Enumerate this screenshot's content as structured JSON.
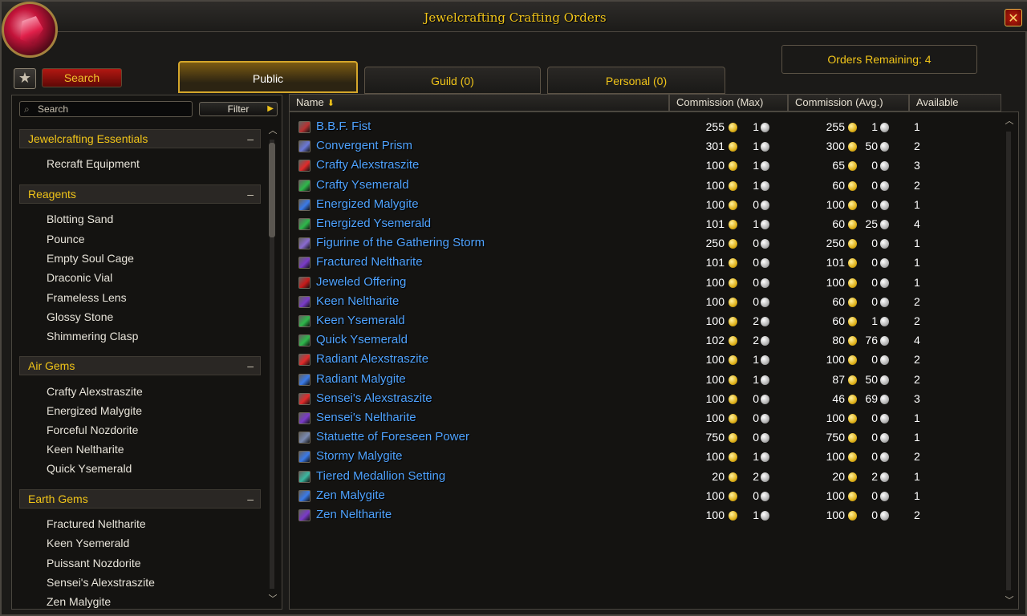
{
  "window": {
    "title": "Jewelcrafting Crafting Orders",
    "close_glyph": "✕"
  },
  "toolbar": {
    "star_glyph": "★",
    "search_label": "Search"
  },
  "tabs": [
    {
      "label": "Public",
      "active": true
    },
    {
      "label": "Guild (0)",
      "active": false
    },
    {
      "label": "Personal (0)",
      "active": false
    }
  ],
  "orders_remaining": "Orders Remaining: 4",
  "sidebar": {
    "search_placeholder": "Search",
    "filter_label": "Filter",
    "categories": [
      {
        "name": "Jewelcrafting Essentials",
        "items": [
          "Recraft Equipment"
        ]
      },
      {
        "name": "Reagents",
        "items": [
          "Blotting Sand",
          "Pounce",
          "Empty Soul Cage",
          "Draconic Vial",
          "Frameless Lens",
          "Glossy Stone",
          "Shimmering Clasp"
        ]
      },
      {
        "name": "Air Gems",
        "items": [
          "Crafty Alexstraszite",
          "Energized Malygite",
          "Forceful Nozdorite",
          "Keen Neltharite",
          "Quick Ysemerald"
        ]
      },
      {
        "name": "Earth Gems",
        "items": [
          "Fractured Neltharite",
          "Keen Ysemerald",
          "Puissant Nozdorite",
          "Sensei's Alexstraszite",
          "Zen Malygite"
        ]
      }
    ]
  },
  "table": {
    "columns": [
      "Name",
      "Commission (Max)",
      "Commission (Avg.)",
      "Available"
    ],
    "rows": [
      {
        "name": "B.B.F. Fist",
        "icon_color": "#b83232",
        "max_g": "255",
        "max_s": "1",
        "avg_g": "255",
        "avg_s": "1",
        "available": "1"
      },
      {
        "name": "Convergent Prism",
        "icon_color": "#6a78d8",
        "max_g": "301",
        "max_s": "1",
        "avg_g": "300",
        "avg_s": "50",
        "available": "2"
      },
      {
        "name": "Crafty Alexstraszite",
        "icon_color": "#e02a2a",
        "max_g": "100",
        "max_s": "1",
        "avg_g": "65",
        "avg_s": "0",
        "available": "3"
      },
      {
        "name": "Crafty Ysemerald",
        "icon_color": "#2eb84a",
        "max_g": "100",
        "max_s": "1",
        "avg_g": "60",
        "avg_s": "0",
        "available": "2"
      },
      {
        "name": "Energized Malygite",
        "icon_color": "#3a7ae8",
        "max_g": "100",
        "max_s": "0",
        "avg_g": "100",
        "avg_s": "0",
        "available": "1"
      },
      {
        "name": "Energized Ysemerald",
        "icon_color": "#2eb84a",
        "max_g": "101",
        "max_s": "1",
        "avg_g": "60",
        "avg_s": "25",
        "available": "4"
      },
      {
        "name": "Figurine of the Gathering Storm",
        "icon_color": "#8a6ad0",
        "max_g": "250",
        "max_s": "0",
        "avg_g": "250",
        "avg_s": "0",
        "available": "1"
      },
      {
        "name": "Fractured Neltharite",
        "icon_color": "#7a3ac8",
        "max_g": "101",
        "max_s": "0",
        "avg_g": "101",
        "avg_s": "0",
        "available": "1"
      },
      {
        "name": "Jeweled Offering",
        "icon_color": "#c81a1a",
        "max_g": "100",
        "max_s": "0",
        "avg_g": "100",
        "avg_s": "0",
        "available": "1"
      },
      {
        "name": "Keen Neltharite",
        "icon_color": "#7a3ac8",
        "max_g": "100",
        "max_s": "0",
        "avg_g": "60",
        "avg_s": "0",
        "available": "2"
      },
      {
        "name": "Keen Ysemerald",
        "icon_color": "#2eb84a",
        "max_g": "100",
        "max_s": "2",
        "avg_g": "60",
        "avg_s": "1",
        "available": "2"
      },
      {
        "name": "Quick Ysemerald",
        "icon_color": "#2eb84a",
        "max_g": "102",
        "max_s": "2",
        "avg_g": "80",
        "avg_s": "76",
        "available": "4"
      },
      {
        "name": "Radiant Alexstraszite",
        "icon_color": "#e02a2a",
        "max_g": "100",
        "max_s": "1",
        "avg_g": "100",
        "avg_s": "0",
        "available": "2"
      },
      {
        "name": "Radiant Malygite",
        "icon_color": "#3a7ae8",
        "max_g": "100",
        "max_s": "1",
        "avg_g": "87",
        "avg_s": "50",
        "available": "2"
      },
      {
        "name": "Sensei's Alexstraszite",
        "icon_color": "#e02a2a",
        "max_g": "100",
        "max_s": "0",
        "avg_g": "46",
        "avg_s": "69",
        "available": "3"
      },
      {
        "name": "Sensei's Neltharite",
        "icon_color": "#7a3ac8",
        "max_g": "100",
        "max_s": "0",
        "avg_g": "100",
        "avg_s": "0",
        "available": "1"
      },
      {
        "name": "Statuette of Foreseen Power",
        "icon_color": "#7a8ab0",
        "max_g": "750",
        "max_s": "0",
        "avg_g": "750",
        "avg_s": "0",
        "available": "1"
      },
      {
        "name": "Stormy Malygite",
        "icon_color": "#3a7ae8",
        "max_g": "100",
        "max_s": "1",
        "avg_g": "100",
        "avg_s": "0",
        "available": "2"
      },
      {
        "name": "Tiered Medallion Setting",
        "icon_color": "#3ab8a0",
        "max_g": "20",
        "max_s": "2",
        "avg_g": "20",
        "avg_s": "2",
        "available": "1"
      },
      {
        "name": "Zen Malygite",
        "icon_color": "#3a7ae8",
        "max_g": "100",
        "max_s": "0",
        "avg_g": "100",
        "avg_s": "0",
        "available": "1"
      },
      {
        "name": "Zen Neltharite",
        "icon_color": "#7a3ac8",
        "max_g": "100",
        "max_s": "1",
        "avg_g": "100",
        "avg_s": "0",
        "available": "2"
      }
    ]
  },
  "scroll": {
    "up_glyph": "︿",
    "down_glyph": "﹀"
  }
}
